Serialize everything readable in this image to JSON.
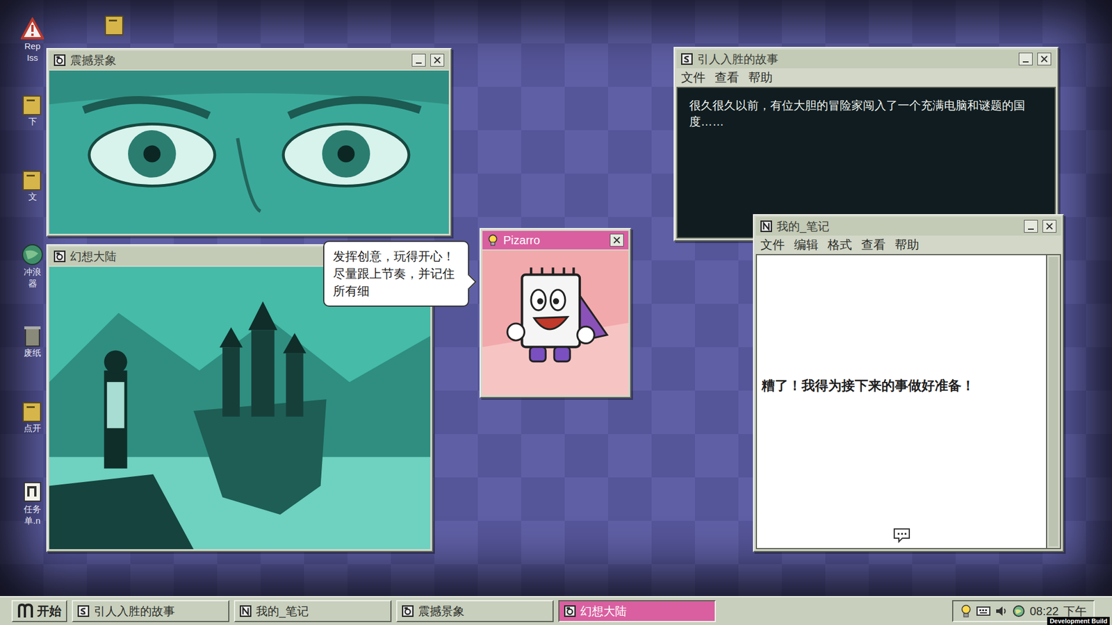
{
  "desktop_icons": [
    {
      "lines": [
        "Rep",
        "Iss"
      ],
      "kind": "warning"
    },
    {
      "lines": [],
      "kind": "folder"
    },
    {
      "lines": [
        "下"
      ],
      "kind": "folder"
    },
    {
      "lines": [
        "文"
      ],
      "kind": "folder"
    },
    {
      "lines": [
        "冲浪",
        "器"
      ],
      "kind": "globe"
    },
    {
      "lines": [
        "废纸"
      ],
      "kind": "bin"
    },
    {
      "lines": [
        "点开"
      ],
      "kind": "folder"
    },
    {
      "lines": [
        "任务",
        "单.n"
      ],
      "kind": "note"
    }
  ],
  "windows": [
    {
      "title": "震撼景象",
      "kind": "eyes"
    },
    {
      "title": "幻想大陆",
      "kind": "land"
    },
    {
      "title": "引人入胜的故事",
      "kind": "story",
      "menu": [
        "文件",
        "查看",
        "帮助"
      ],
      "text": "很久很久以前，有位大胆的冒险家闯入了一个充满电脑和谜题的国度……"
    },
    {
      "title": "我的_笔记",
      "kind": "notes",
      "menu": [
        "文件",
        "编辑",
        "格式",
        "查看",
        "帮助"
      ],
      "text": "糟了！我得为接下来的事做好准备！"
    },
    {
      "title": "Pizarro",
      "kind": "assistant",
      "speech": "发挥创意，玩得开心！尽量跟上节奏，并记住所有细"
    }
  ],
  "taskbar": {
    "start": "开始",
    "items": [
      {
        "label": "引人入胜的故事",
        "kind": "story",
        "selected": false
      },
      {
        "label": "我的_笔记",
        "kind": "notes",
        "selected": false
      },
      {
        "label": "震撼景象",
        "kind": "image",
        "selected": false
      },
      {
        "label": "幻想大陆",
        "kind": "image",
        "selected": true
      }
    ],
    "clock": "08:22",
    "period": "下午"
  },
  "build_tag": "Development Build"
}
